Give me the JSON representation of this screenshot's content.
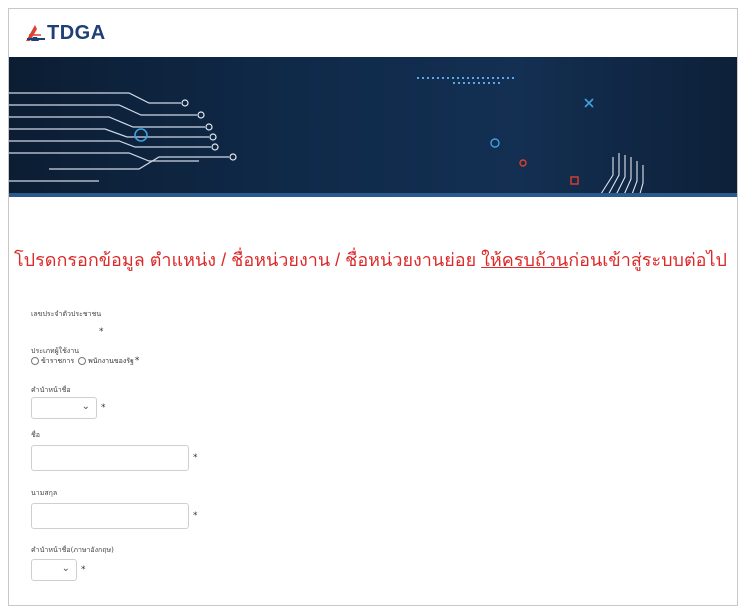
{
  "brand": {
    "logo_text": "TDGA"
  },
  "notice": {
    "part1": "โปรดกรอกข้อมูล ตำแหน่ง / ชื่อหน่วยงาน / ชื่อหน่วยงานย่อย ",
    "emphasis": "ให้ครบถ้วน",
    "part2": "ก่อนเข้าสู่ระบบต่อไป"
  },
  "form": {
    "required_mark": "*",
    "citizen_id": {
      "label": "เลขประจำตัวประชาชน"
    },
    "user_type": {
      "label": "ประเภทผู้ใช้งาน",
      "option1": "ข้าราชการ",
      "option2": "พนักงานของรัฐ"
    },
    "title_prefix": {
      "label": "คำนำหน้าชื่อ"
    },
    "first_name": {
      "label": "ชื่อ"
    },
    "last_name": {
      "label": "นามสกุล"
    },
    "title_prefix_en": {
      "label": "คำนำหน้าชื่อ(ภาษาอังกฤษ)"
    }
  },
  "colors": {
    "notice": "#dc2a2a",
    "banner": "#0f2a49",
    "brand": "#1e3f78"
  }
}
